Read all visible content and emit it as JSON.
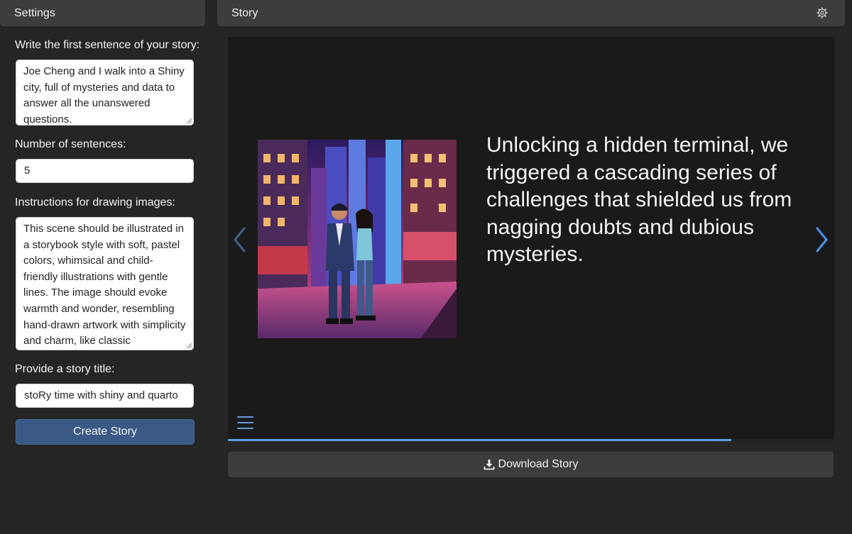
{
  "sidebar": {
    "title": "Settings",
    "first_sentence": {
      "label": "Write the first sentence of your story:",
      "value": "Joe Cheng and I walk into a Shiny city, full of mysteries and data to answer all the unanswered questions."
    },
    "num_sentences": {
      "label": "Number of sentences:",
      "value": "5"
    },
    "image_instructions": {
      "label": "Instructions for drawing images:",
      "value": "This scene should be illustrated in a storybook style with soft, pastel colors, whimsical and child-friendly illustrations with gentle lines. The image should evoke warmth and wonder, resembling hand-drawn artwork with simplicity and charm, like classic"
    },
    "story_title": {
      "label": "Provide a story title:",
      "value": "stoRy time with shiny and quarto"
    },
    "create_label": "Create Story"
  },
  "main": {
    "title": "Story",
    "slide_text": "Unlocking a hidden terminal, we triggered a cascading series of challenges that shielded us from nagging doubts and dubious mysteries.",
    "progress_fraction": 0.83,
    "download_label": "Download Story"
  },
  "icons": {
    "settings": "gear-icon",
    "prev": "chevron-left-icon",
    "next": "chevron-right-icon",
    "menu": "hamburger-menu-icon",
    "download": "download-icon"
  },
  "colors": {
    "accent": "#5f9de3",
    "button_primary": "#3a5a85",
    "panel_header": "#3d3d3d",
    "carousel_bg": "#1a1a1a"
  }
}
